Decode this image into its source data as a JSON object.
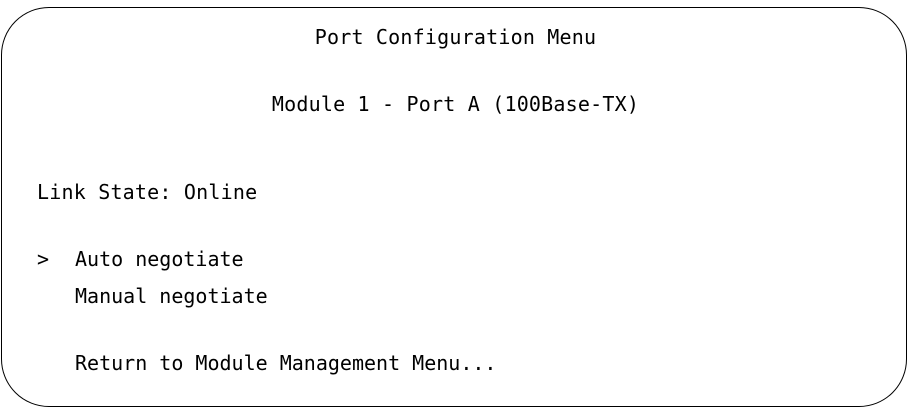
{
  "menu": {
    "title": "Port Configuration Menu",
    "subtitle": "Module 1 - Port A (100Base-TX)",
    "link_state": {
      "label": "Link State:",
      "value": "Online"
    },
    "cursor": ">",
    "options": [
      {
        "label": "Auto negotiate",
        "selected": true
      },
      {
        "label": "Manual negotiate",
        "selected": false
      }
    ],
    "return_label": "Return to Module Management Menu..."
  }
}
